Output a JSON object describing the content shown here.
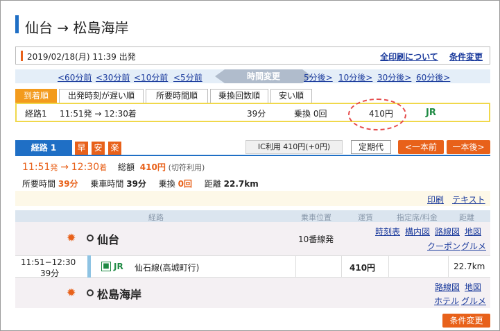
{
  "title": "仙台 → 松島海岸",
  "datetime": "2019/02/18(月) 11:39 出発",
  "header_links": {
    "print_info": "全印刷について",
    "condition_change": "条件変更"
  },
  "nav": {
    "prev": [
      "<60分前",
      "<30分前",
      "<10分前",
      "<5分前"
    ],
    "time_change": "時間変更",
    "next": [
      "5分後>",
      "10分後>",
      "30分後>",
      "60分後>"
    ]
  },
  "sort_tabs": [
    "到着順",
    "出発時刻が遅い順",
    "所要時間順",
    "乗換回数順",
    "安い順"
  ],
  "route_list": [
    {
      "name": "経路1",
      "time": "11:51発 → 12:30着",
      "duration": "39分",
      "transfers": "乗換 0回",
      "fare": "410円",
      "line": "JR"
    }
  ],
  "route_tab": "経路 1",
  "badges": [
    "早",
    "安",
    "楽"
  ],
  "ic_fare": "IC利用 410円(+0円)",
  "buttons": {
    "commuter": "定期代",
    "prev": "<一本前",
    "next": "一本後>"
  },
  "summary": {
    "dep": "11:51",
    "dep_suffix": "発",
    "arrow": "→",
    "arr": "12:30",
    "arr_suffix": "着",
    "total_label": "総額",
    "total": "410円",
    "ticket_note": "(切符利用)",
    "req_label": "所要時間",
    "req": "39分",
    "ride_label": "乗車時間",
    "ride": "39分",
    "transfer_label": "乗換",
    "transfer": "0回",
    "dist_label": "距離",
    "dist": "22.7km"
  },
  "print_links": {
    "print": "印刷",
    "text": "テキスト"
  },
  "table_headers": [
    "経路",
    "乗車位置",
    "運賃",
    "指定席/料金",
    "距離"
  ],
  "stations": [
    {
      "name": "仙台",
      "platform": "10番線発",
      "links": [
        "時刻表",
        "構内図",
        "路線図",
        "地図",
        "クーポン",
        "グルメ"
      ]
    },
    {
      "name": "松島海岸",
      "links": [
        "路線図",
        "地図",
        "ホテル",
        "グルメ"
      ]
    }
  ],
  "segment": {
    "time": "11:51−12:30",
    "duration": "39分",
    "line": "JR",
    "line_detail": "仙石線(高城町行)",
    "fare": "410円",
    "distance": "22.7km"
  },
  "footer_button": "条件変更",
  "colors": {
    "accent_blue": "#1f6fc5",
    "accent_orange": "#e8611a",
    "jr_green": "#1e8a43"
  }
}
